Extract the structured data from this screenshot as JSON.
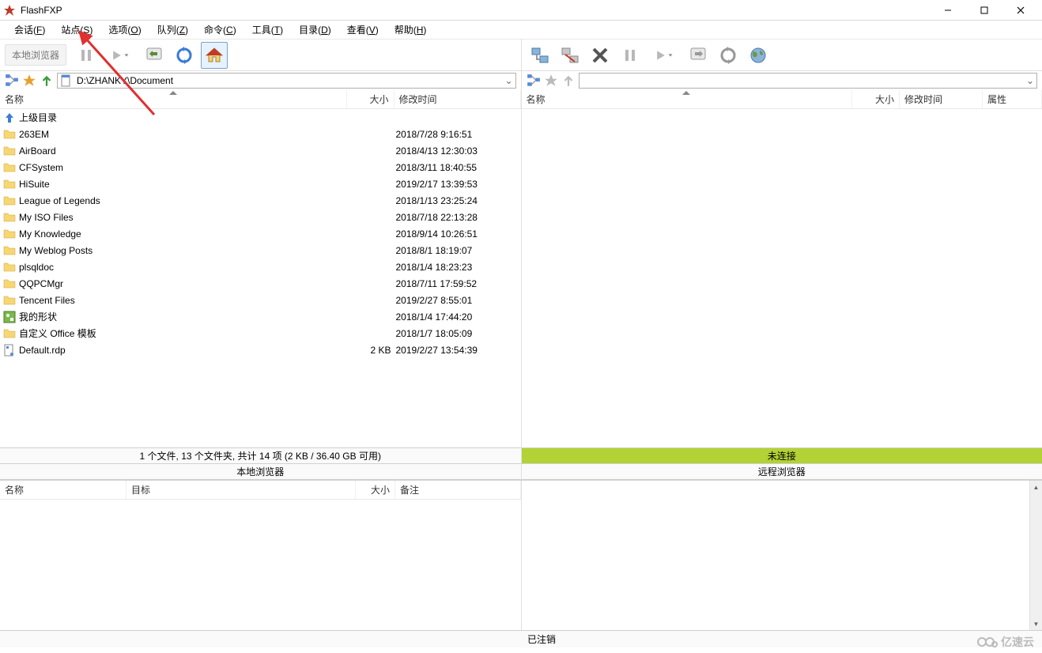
{
  "window": {
    "title": "FlashFXP"
  },
  "menu": {
    "session": "会话(F)",
    "site": "站点(S)",
    "options": "选项(O)",
    "queue": "队列(Z)",
    "commands": "命令(C)",
    "tools": "工具(T)",
    "directory": "目录(D)",
    "view": "查看(V)",
    "help": "帮助(H)"
  },
  "toolbar": {
    "localBrowserLabel": "本地浏览器"
  },
  "local": {
    "path": "D:\\ZHANKY\\Document",
    "headers": {
      "name": "名称",
      "size": "大小",
      "mtime": "修改时间"
    },
    "parentLabel": "上级目录",
    "files": [
      {
        "name": "263EM",
        "type": "folder",
        "size": "",
        "mtime": "2018/7/28 9:16:51"
      },
      {
        "name": "AirBoard",
        "type": "folder",
        "size": "",
        "mtime": "2018/4/13 12:30:03"
      },
      {
        "name": "CFSystem",
        "type": "folder",
        "size": "",
        "mtime": "2018/3/11 18:40:55"
      },
      {
        "name": "HiSuite",
        "type": "folder",
        "size": "",
        "mtime": "2019/2/17 13:39:53"
      },
      {
        "name": "League of Legends",
        "type": "folder",
        "size": "",
        "mtime": "2018/1/13 23:25:24"
      },
      {
        "name": "My ISO Files",
        "type": "folder",
        "size": "",
        "mtime": "2018/7/18 22:13:28"
      },
      {
        "name": "My Knowledge",
        "type": "folder",
        "size": "",
        "mtime": "2018/9/14 10:26:51"
      },
      {
        "name": "My Weblog Posts",
        "type": "folder",
        "size": "",
        "mtime": "2018/8/1 18:19:07"
      },
      {
        "name": "plsqldoc",
        "type": "folder",
        "size": "",
        "mtime": "2018/1/4 18:23:23"
      },
      {
        "name": "QQPCMgr",
        "type": "folder",
        "size": "",
        "mtime": "2018/7/11 17:59:52"
      },
      {
        "name": "Tencent Files",
        "type": "folder",
        "size": "",
        "mtime": "2019/2/27 8:55:01"
      },
      {
        "name": "我的形状",
        "type": "shapes",
        "size": "",
        "mtime": "2018/1/4 17:44:20"
      },
      {
        "name": "自定义 Office 模板",
        "type": "folder",
        "size": "",
        "mtime": "2018/1/7 18:05:09"
      },
      {
        "name": "Default.rdp",
        "type": "file",
        "size": "2 KB",
        "mtime": "2019/2/27 13:54:39"
      }
    ],
    "statusLine1": "1 个文件, 13 个文件夹, 共计 14 项 (2 KB / 36.40 GB 可用)",
    "statusLine2": "本地浏览器"
  },
  "remote": {
    "path": "",
    "headers": {
      "name": "名称",
      "size": "大小",
      "mtime": "修改时间",
      "attr": "属性"
    },
    "statusLine1": "未连接",
    "statusLine2": "远程浏览器"
  },
  "queue": {
    "headers": {
      "name": "名称",
      "target": "目标",
      "size": "大小",
      "remark": "备注"
    }
  },
  "statusbar": {
    "right": "已注销"
  },
  "watermark": "亿速云"
}
